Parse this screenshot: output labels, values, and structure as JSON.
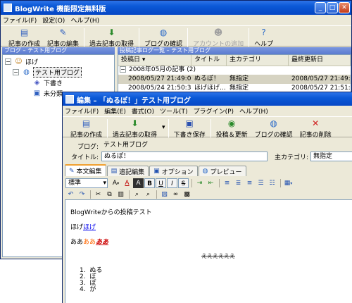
{
  "main_window": {
    "title": "BlogWrite  機能限定無料版",
    "menu": [
      "ファイル(F)",
      "設定(O)",
      "ヘルプ(H)"
    ],
    "toolbar": [
      {
        "label": "記事の作成",
        "icon": "new-post-icon",
        "enabled": true
      },
      {
        "label": "記事の編集",
        "icon": "edit-post-icon",
        "enabled": true
      },
      {
        "label": "過去記事の取得",
        "icon": "fetch-icon",
        "enabled": true
      },
      {
        "label": "ブログの確認",
        "icon": "globe-icon",
        "enabled": true
      },
      {
        "label": "アカウントの追加",
        "icon": "add-account-icon",
        "enabled": false
      },
      {
        "label": "ヘルプ",
        "icon": "help-icon",
        "enabled": true
      }
    ],
    "left_panel_title": "ブログ – テスト用ブログ",
    "tree": {
      "root": "ほげ",
      "blog": "テスト用ブログ",
      "drafts": "下書き",
      "uncategorized": "未分類"
    },
    "right_panel_title": "投稿記事ログ一覧 – テスト用ブログ",
    "list": {
      "columns": [
        "投稿日",
        "タイトル",
        "主カテゴリ",
        "最終更新日"
      ],
      "group": "2008年05月の記事 (2)",
      "rows": [
        {
          "date": "2008/05/27 21:49:01",
          "title": "ぬるぽ！",
          "category": "無指定",
          "updated": "2008/05/27 21:49:35"
        },
        {
          "date": "2008/05/24 21:50:30",
          "title": "ほげほげ...",
          "category": "無指定",
          "updated": "2008/05/27 21:51:07"
        }
      ]
    }
  },
  "editor_window": {
    "title": "編集 – 「ぬるぽ！」テスト用ブログ",
    "menu": [
      "ファイル(F)",
      "編集(E)",
      "書式(O)",
      "ツール(T)",
      "プラグイン(P)",
      "ヘルプ(H)"
    ],
    "toolbar": [
      {
        "label": "記事の作成",
        "icon": "new-post-icon"
      },
      {
        "label": "過去記事の取得",
        "icon": "fetch-icon"
      },
      {
        "label": "下書き保存",
        "icon": "save-icon"
      },
      {
        "label": "投稿＆更新",
        "icon": "publish-icon"
      },
      {
        "label": "ブログの確認",
        "icon": "globe-icon"
      },
      {
        "label": "記事の削除",
        "icon": "delete-icon"
      }
    ],
    "blog_label": "ブログ:",
    "blog_value": "テスト用ブログ",
    "title_label": "タイトル:",
    "title_value": "ぬるぽ！",
    "category_label": "主カテゴリ:",
    "category_value": "無指定",
    "tabs": [
      "本文編集",
      "追記編集",
      "オプション",
      "プレビュー"
    ],
    "style_select": "標準",
    "content": {
      "line1": "BlogWriteからの投稿テスト",
      "line2_plain": "ほげ",
      "line2_link": "ほげ",
      "line3_a": "ああ",
      "line3_b": "ああ",
      "line3_c": "ああ",
      "center_text": "ええええええ",
      "list": [
        "ぬる",
        "ぽ",
        "ぽ",
        "が"
      ]
    }
  },
  "colors": {
    "titlebar": "#0a58d6",
    "link": "#0000ee",
    "orange": "#ff6600",
    "red": "#cc0000"
  }
}
